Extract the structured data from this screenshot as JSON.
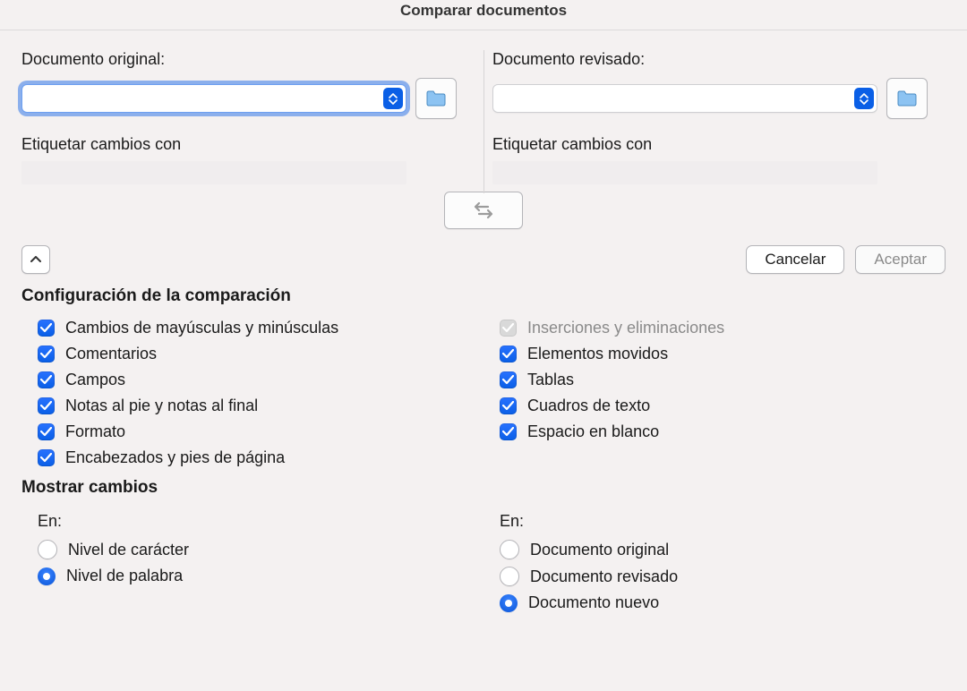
{
  "title": "Comparar documentos",
  "original": {
    "label": "Documento original:",
    "tag_label": "Etiquetar cambios con"
  },
  "revised": {
    "label": "Documento revisado:",
    "tag_label": "Etiquetar cambios con"
  },
  "buttons": {
    "cancel": "Cancelar",
    "accept": "Aceptar"
  },
  "settings_title": "Configuración de la comparación",
  "settings_left": [
    "Cambios de mayúsculas y minúsculas",
    "Comentarios",
    "Campos",
    "Notas al pie y notas al final",
    "Formato",
    "Encabezados y pies de página"
  ],
  "settings_right": [
    "Inserciones y eliminaciones",
    "Elementos movidos",
    "Tablas",
    "Cuadros de texto",
    "Espacio en blanco"
  ],
  "show_changes_title": "Mostrar cambios",
  "show_in_label": "En:",
  "level_options": [
    "Nivel de carácter",
    "Nivel de palabra"
  ],
  "doc_options": [
    "Documento original",
    "Documento revisado",
    "Documento nuevo"
  ]
}
